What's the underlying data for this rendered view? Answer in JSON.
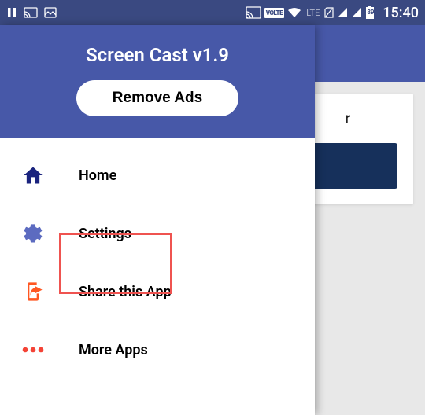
{
  "status": {
    "time": "15:40",
    "battery": "89",
    "lte_label": "LTE",
    "volte_label": "VOLTE"
  },
  "background": {
    "card_title_fragment": "r"
  },
  "drawer": {
    "title": "Screen Cast v1.9",
    "remove_ads_label": "Remove Ads",
    "items": [
      {
        "label": "Home",
        "icon": "home"
      },
      {
        "label": "Settings",
        "icon": "gear"
      },
      {
        "label": "Share this App",
        "icon": "share"
      },
      {
        "label": "More Apps",
        "icon": "dots"
      }
    ]
  },
  "colors": {
    "primary": "#4758a8",
    "status_bar": "#3a4981",
    "accent_home": "#1a237e",
    "accent_gear": "#5c6bc0",
    "accent_share": "#ff5722",
    "accent_dots": "#f44336",
    "highlight": "#ef5350"
  }
}
